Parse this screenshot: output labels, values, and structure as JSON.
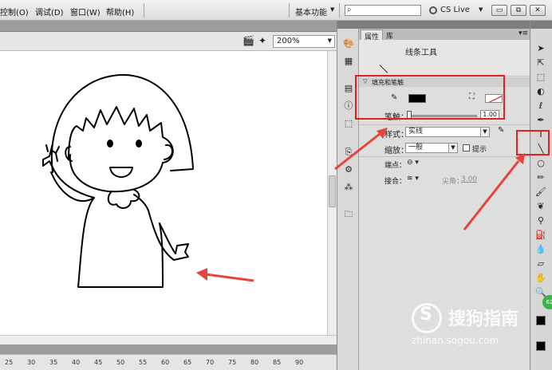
{
  "menu": {
    "items": [
      "控制(O)",
      "调试(D)",
      "窗口(W)",
      "帮助(H)"
    ],
    "workspace": "基本功能",
    "search_value": "",
    "cs_live": "CS Live",
    "window_buttons": [
      "▭",
      "⧉",
      "✕"
    ]
  },
  "stage": {
    "zoom": "200%",
    "ruler_ticks": [
      "25",
      "30",
      "35",
      "40",
      "45",
      "50",
      "55",
      "60",
      "65",
      "70",
      "75",
      "80",
      "85",
      "90"
    ]
  },
  "properties": {
    "tabs": [
      "属性",
      "库"
    ],
    "tool_name": "线条工具",
    "section_title": "填充和笔触",
    "stroke_label": "笔触：",
    "stroke_value": "1.00",
    "style_label": "样式：",
    "style_value": "实线",
    "scale_label": "缩放：",
    "scale_value": "一般",
    "hint_label": "提示",
    "cap_label": "端点：",
    "join_label": "接合：",
    "miter_label": "尖角：",
    "miter_value": "3.00"
  },
  "watermark": {
    "text": "搜狗指南",
    "url": "zhinan.sogou.com",
    "badge": "62"
  },
  "colors": {
    "stroke": "#000000",
    "annotation_red": "#e02020",
    "arrow_red": "#e8433a"
  },
  "icons": [
    "search-icon",
    "cs-live-icon",
    "pencil-icon",
    "paint-bucket-icon",
    "line-tool-icon",
    "selection-icon"
  ]
}
